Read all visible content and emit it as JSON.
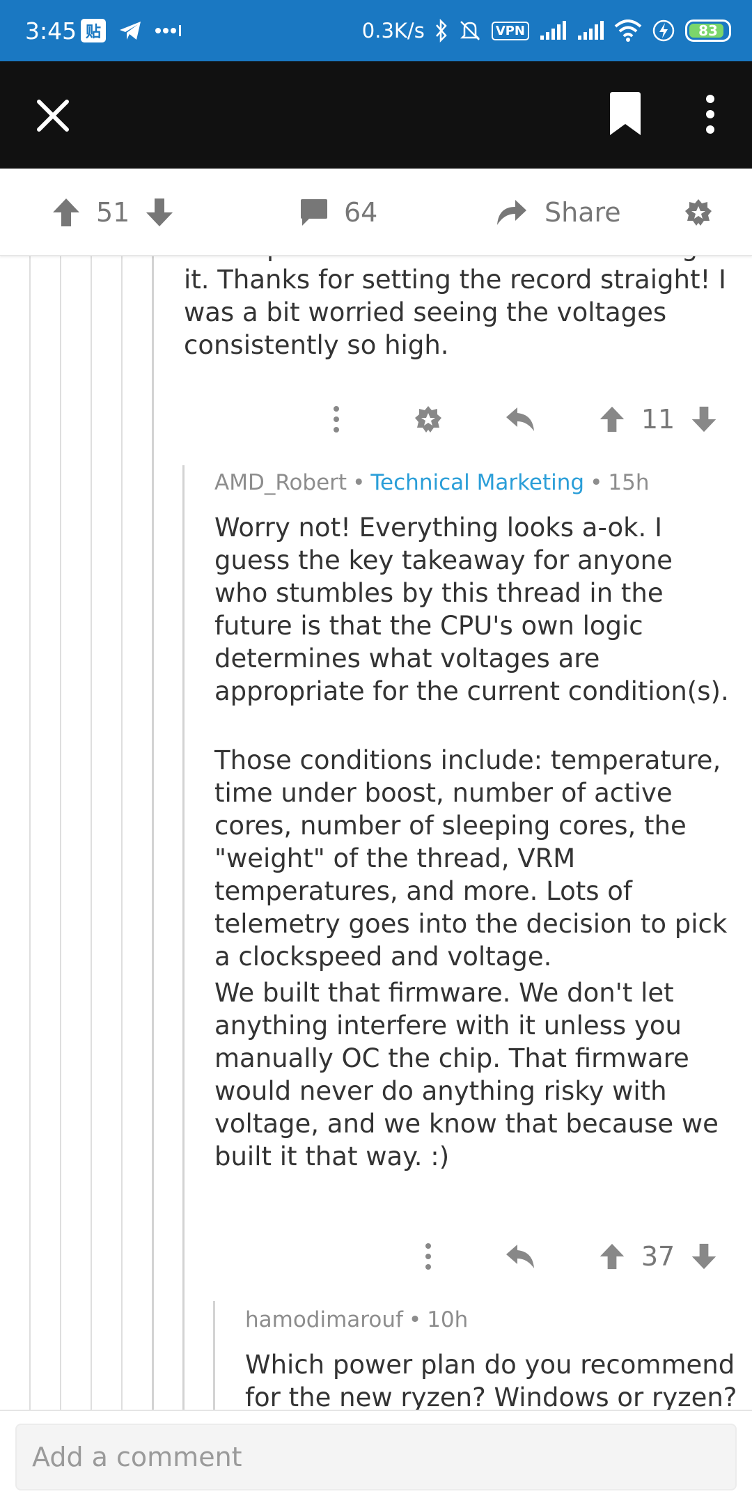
{
  "status_bar": {
    "time": "3:45",
    "tie_label": "贴",
    "net_speed": "0.3K/s",
    "vpn_label": "VPN",
    "battery": "83"
  },
  "post_actions": {
    "upvotes": "51",
    "comments": "64",
    "share_label": "Share"
  },
  "parent_comment": {
    "text": "I'll keep that in mind while I'm tweaking it. Thanks for setting the record straight! I was a bit worried seeing the voltages consistently so high.",
    "score": "11"
  },
  "reply": {
    "author": "AMD_Robert",
    "flair": "Technical Marketing",
    "age": "15h",
    "paragraph1": "Worry not! Everything looks a-ok. I guess the key takeaway for anyone who stumbles by this thread in the future is that the CPU's own logic determines what voltages are appropriate for the current condition(s).",
    "paragraph2": "Those conditions include: temperature, time under boost, number of active cores, number of sleeping cores, the \"weight\" of the thread, VRM temperatures, and more. Lots of telemetry goes into the decision to pick a clockspeed and voltage.",
    "paragraph3": "We built that firmware. We don't let anything interfere with it unless you manually OC the chip. That firmware would never do anything risky with voltage, and we know that because we built it that way. :)",
    "score": "37"
  },
  "child_comment": {
    "author": "hamodimarouf",
    "age": "10h",
    "text": "Which power plan do you recommend for the new ryzen? Windows or ryzen?"
  },
  "comment_box": {
    "placeholder": "Add a comment"
  },
  "icons": {
    "close": "close-icon",
    "bookmark": "bookmark-icon",
    "more": "more-vertical-icon",
    "upvote": "upvote-arrow-icon",
    "downvote": "downvote-arrow-icon",
    "comment": "comment-bubble-icon",
    "share": "share-arrow-icon",
    "award": "award-icon",
    "reply": "reply-icon"
  },
  "colors": {
    "status_bar": "#1a78c2",
    "toolbar": "#111111",
    "flair": "#2a9ed8",
    "battery_fill": "#7bd66a"
  }
}
